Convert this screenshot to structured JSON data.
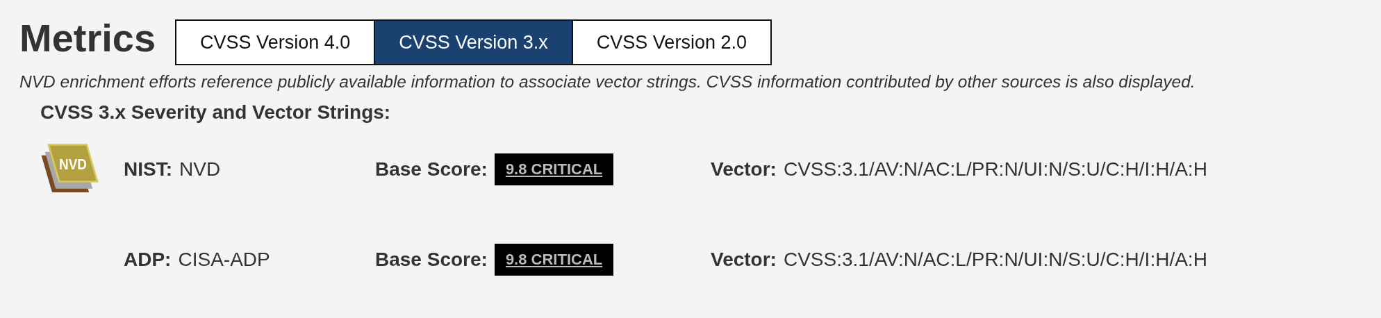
{
  "heading": "Metrics",
  "tabs": [
    {
      "label": "CVSS Version 4.0",
      "selected": false
    },
    {
      "label": "CVSS Version 3.x",
      "selected": true
    },
    {
      "label": "CVSS Version 2.0",
      "selected": false
    }
  ],
  "note": "NVD enrichment efforts reference publicly available information to associate vector strings. CVSS information contributed by other sources is also displayed.",
  "section_title": "CVSS 3.x Severity and Vector Strings:",
  "rows": [
    {
      "logo_text": "NVD",
      "source_label": "NIST:",
      "source": "NVD",
      "score_label": "Base Score:",
      "score": "9.8 CRITICAL",
      "vector_label": "Vector:",
      "vector": "CVSS:3.1/AV:N/AC:L/PR:N/UI:N/S:U/C:H/I:H/A:H"
    },
    {
      "source_label": "ADP:",
      "source": "CISA-ADP",
      "score_label": "Base Score:",
      "score": "9.8 CRITICAL",
      "vector_label": "Vector:",
      "vector": "CVSS:3.1/AV:N/AC:L/PR:N/UI:N/S:U/C:H/I:H/A:H"
    }
  ]
}
